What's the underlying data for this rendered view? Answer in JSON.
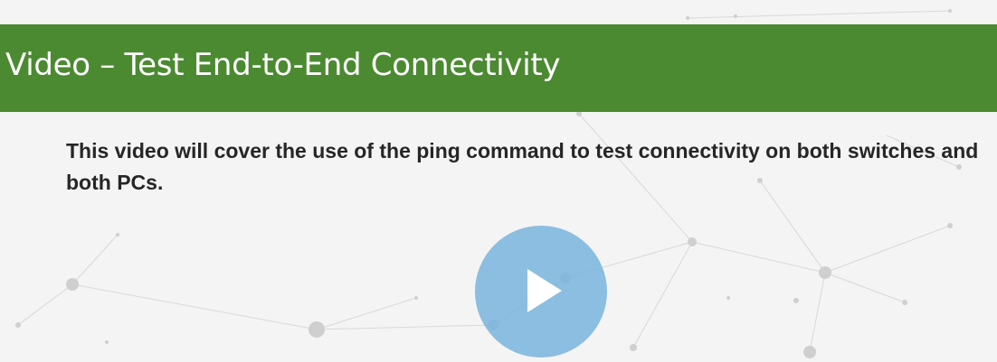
{
  "slide": {
    "title": "Video – Test End-to-End Connectivity",
    "body": "This video will cover the use of the ping command to test connectivity on both switches and both PCs."
  },
  "player": {
    "play_icon": "play-icon"
  },
  "colors": {
    "title_bar": "#4b8a31",
    "title_text": "#ffffff",
    "body_text": "#262626",
    "slide_background": "#f4f4f4",
    "play_button": "#78b4dc"
  }
}
